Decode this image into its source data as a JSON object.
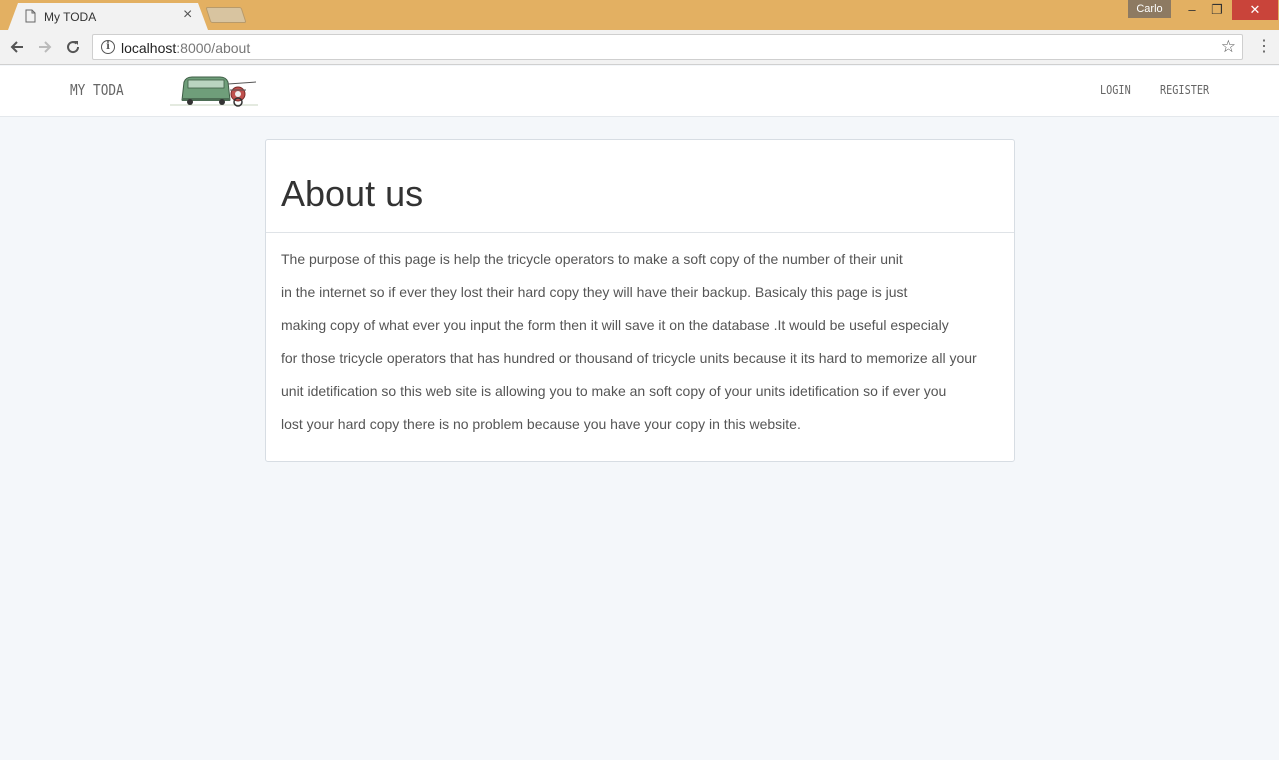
{
  "browser": {
    "tab_title": "My TODA",
    "tab_close": "×",
    "profile_name": "Carlo",
    "url_host": "localhost",
    "url_path": ":8000/about",
    "window_controls": {
      "minimize": "–",
      "maximize": "❐",
      "close": "✕"
    }
  },
  "site": {
    "brand": "MY TODA",
    "nav": {
      "login": "LOGIN",
      "register": "REGISTER"
    }
  },
  "page": {
    "title": "About us",
    "lines": [
      "The purpose of this page is help the tricycle operators to make a soft copy of the number of their unit",
      "in the internet so if ever they lost their hard copy they will have their backup. Basicaly this page is just",
      "making copy of what ever you input the form then it will save it on the database .It would be useful especialy",
      "for those tricycle operators that has hundred or thousand of tricycle units because it its hard to memorize all your",
      "unit idetification so this web site is allowing you to make an soft copy of your units idetification so if ever you",
      "lost your hard copy there is no problem because you have your copy in this website."
    ]
  },
  "colors": {
    "titlebar": "#e3b062",
    "page_background": "#f4f7fa",
    "close_button": "#c9443a"
  },
  "icons": [
    "document-icon",
    "close-icon",
    "back-arrow-icon",
    "forward-arrow-icon",
    "reload-icon",
    "info-icon",
    "star-icon",
    "menu-icon",
    "tricycle-logo"
  ]
}
